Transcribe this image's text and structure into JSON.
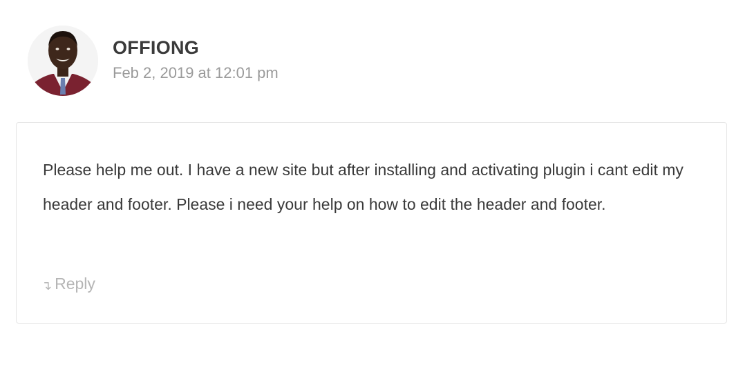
{
  "comment": {
    "author": "OFFIONG",
    "date": "Feb 2, 2019 at 12:01 pm",
    "text": "Please help me out. I have a new site but after installing and activating plugin i cant edit my header and footer. Please i need your help on how to edit the header and footer.",
    "reply_label": "Reply",
    "reply_icon": "reply-arrow-icon"
  },
  "colors": {
    "author": "#3a3a3a",
    "date": "#9a9a9a",
    "body_text": "#3a3a3a",
    "reply": "#b5b5b5",
    "border": "#e6e6e6"
  }
}
